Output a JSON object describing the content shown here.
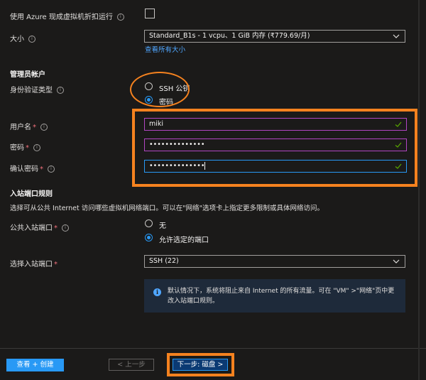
{
  "spot": {
    "label": "使用 Azure 现成虚拟机折扣运行"
  },
  "size": {
    "label": "大小",
    "value": "Standard_B1s - 1 vcpu、1 GiB 内存 (₹779.69/月)",
    "link": "查看所有大小"
  },
  "admin": {
    "section_title": "管理员帐户",
    "auth_label": "身份验证类型",
    "auth_options": [
      "SSH 公钥",
      "密码"
    ],
    "auth_selected": "密码",
    "username_label": "用户名",
    "username_value": "miki",
    "password_label": "密码",
    "password_value": "••••••••••••••",
    "confirm_label": "确认密码",
    "confirm_value": "••••••••••••••",
    "required_mark": "*"
  },
  "inbound": {
    "section_title": "入站端口规则",
    "description": "选择可从公共 Internet 访问哪些虚拟机网络端口。可以在\"网络\"选项卡上指定更多限制或具体网络访问。",
    "public_label": "公共入站端口",
    "public_options": [
      "无",
      "允许选定的端口"
    ],
    "public_selected": "允许选定的端口",
    "select_label": "选择入站端口",
    "select_value": "SSH (22)",
    "info_text": "默认情况下，系统将阻止来自 Internet 的所有流量。可在 \"VM\" >\"网络\"页中更改入站端口规则。"
  },
  "footer": {
    "review_create": "查看 + 创建",
    "previous": "< 上一步",
    "next": "下一步: 磁盘 >"
  },
  "colors": {
    "accent": "#2899f5",
    "annotation": "#f5821f",
    "focus_purple": "#b146c2",
    "valid_green": "#57a300"
  },
  "icons": {
    "info": "i"
  }
}
